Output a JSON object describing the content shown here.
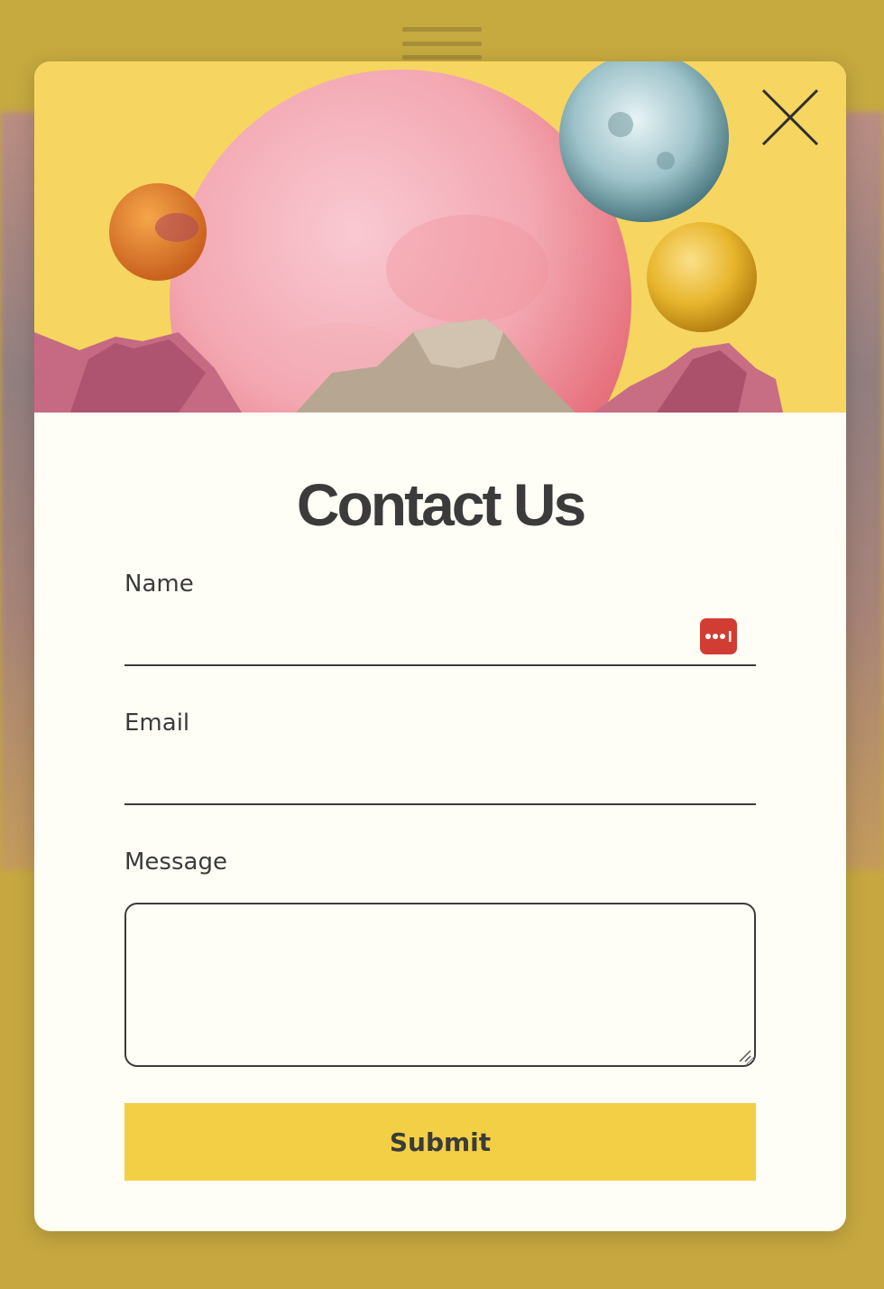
{
  "modal": {
    "title": "Contact Us",
    "close_icon": "close-icon"
  },
  "form": {
    "name_label": "Name",
    "name_value": "",
    "email_label": "Email",
    "email_value": "",
    "message_label": "Message",
    "message_value": "",
    "submit_label": "Submit",
    "password_manager_icon": "password-manager-icon"
  },
  "colors": {
    "accent_yellow": "#f3cf45",
    "hero_background": "#f6d561",
    "text_dark": "#3b3b3b",
    "password_icon_red": "#d23d33",
    "modal_background": "#fffef6"
  }
}
